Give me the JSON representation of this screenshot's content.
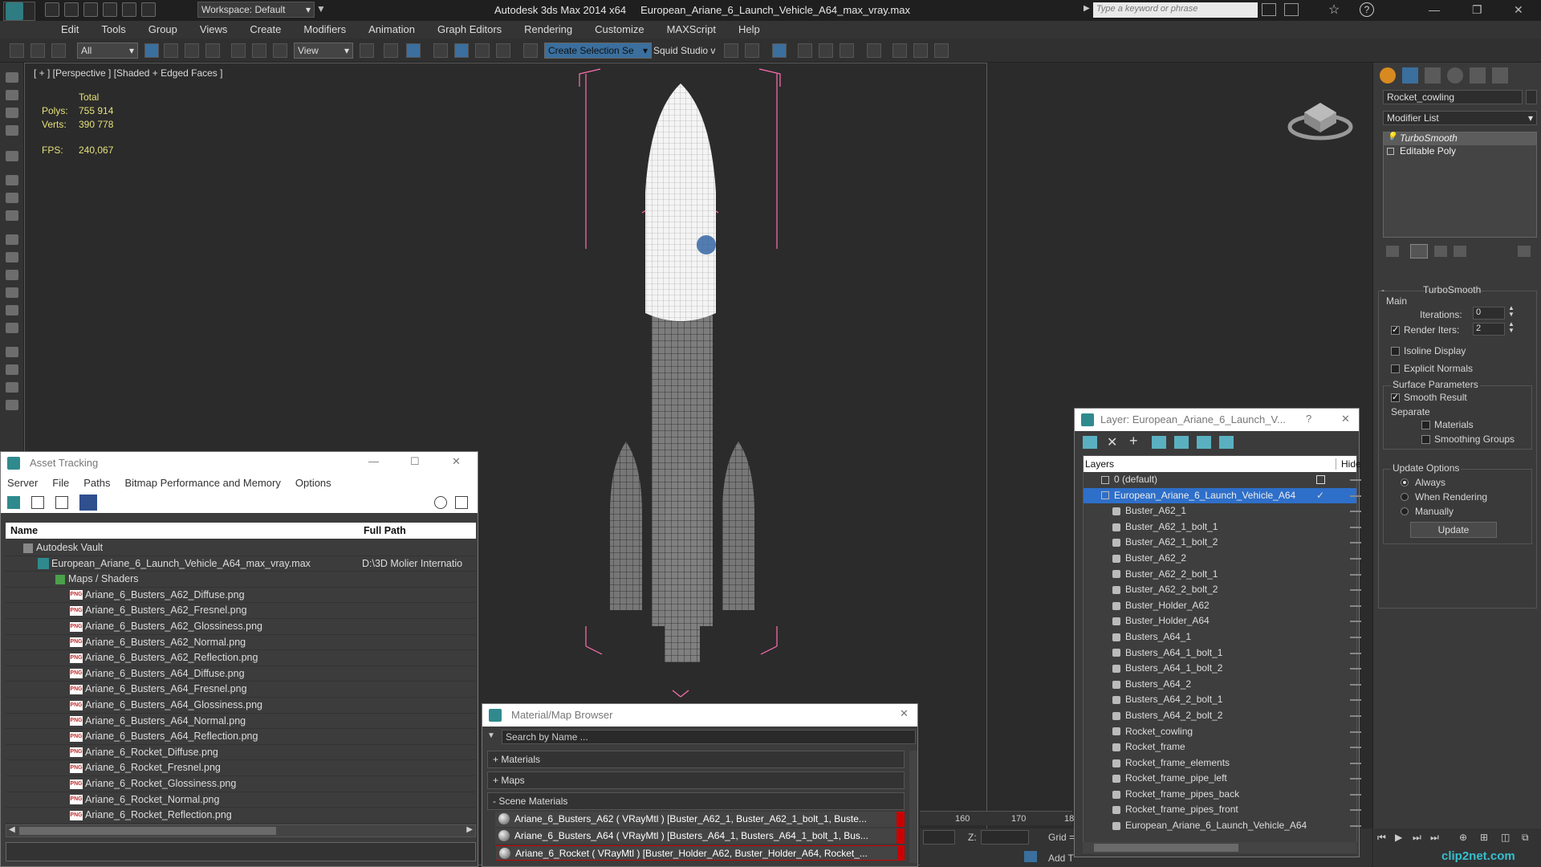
{
  "titlebar": {
    "workspace": "Workspace: Default",
    "app_name": "Autodesk 3ds Max  2014 x64",
    "file_name": "European_Ariane_6_Launch_Vehicle_A64_max_vray.max",
    "search_placeholder": "Type a keyword or phrase"
  },
  "menubar": [
    "Edit",
    "Tools",
    "Group",
    "Views",
    "Create",
    "Modifiers",
    "Animation",
    "Graph Editors",
    "Rendering",
    "Customize",
    "MAXScript",
    "Help"
  ],
  "toolbar": {
    "filter": "All",
    "ref_coord": "View",
    "selection_set": "Create Selection Se",
    "squid": "Squid Studio v"
  },
  "viewport": {
    "label": "[ + ] [Perspective ] [Shaded + Edged Faces ]",
    "stats": {
      "total_label": "Total",
      "polys_label": "Polys:",
      "polys_value": "755 914",
      "verts_label": "Verts:",
      "verts_value": "390 778",
      "fps_label": "FPS:",
      "fps_value": "240,067"
    }
  },
  "command_panel": {
    "object_name": "Rocket_cowling",
    "modifier_list": "Modifier List",
    "stack": [
      "TurboSmooth",
      "Editable Poly"
    ],
    "rollout_title": "TurboSmooth",
    "main_label": "Main",
    "iterations_label": "Iterations:",
    "iterations_value": "0",
    "render_iters_label": "Render Iters:",
    "render_iters_value": "2",
    "isoline_label": "Isoline Display",
    "explicit_label": "Explicit Normals",
    "surface_label": "Surface Parameters",
    "smooth_result_label": "Smooth Result",
    "separate_label": "Separate",
    "materials_label": "Materials",
    "smoothing_groups_label": "Smoothing Groups",
    "update_options_label": "Update Options",
    "always_label": "Always",
    "when_rendering_label": "When Rendering",
    "manually_label": "Manually",
    "update_button": "Update"
  },
  "asset_tracking": {
    "title": "Asset Tracking",
    "menu": [
      "Server",
      "File",
      "Paths",
      "Bitmap Performance and Memory",
      "Options"
    ],
    "col_name": "Name",
    "col_path": "Full Path",
    "vault": "Autodesk Vault",
    "max_file": "European_Ariane_6_Launch_Vehicle_A64_max_vray.max",
    "max_path": "D:\\3D Molier Internatio",
    "maps_folder": "Maps / Shaders",
    "maps": [
      "Ariane_6_Busters_A62_Diffuse.png",
      "Ariane_6_Busters_A62_Fresnel.png",
      "Ariane_6_Busters_A62_Glossiness.png",
      "Ariane_6_Busters_A62_Normal.png",
      "Ariane_6_Busters_A62_Reflection.png",
      "Ariane_6_Busters_A64_Diffuse.png",
      "Ariane_6_Busters_A64_Fresnel.png",
      "Ariane_6_Busters_A64_Glossiness.png",
      "Ariane_6_Busters_A64_Normal.png",
      "Ariane_6_Busters_A64_Reflection.png",
      "Ariane_6_Rocket_Diffuse.png",
      "Ariane_6_Rocket_Fresnel.png",
      "Ariane_6_Rocket_Glossiness.png",
      "Ariane_6_Rocket_Normal.png",
      "Ariane_6_Rocket_Reflection.png"
    ]
  },
  "layer_window": {
    "title": "Layer: European_Ariane_6_Launch_V...",
    "help": "?",
    "col_layers": "Layers",
    "col_hide": "Hide",
    "default_layer": "0 (default)",
    "active_layer": "European_Ariane_6_Launch_Vehicle_A64",
    "objects": [
      "Buster_A62_1",
      "Buster_A62_1_bolt_1",
      "Buster_A62_1_bolt_2",
      "Buster_A62_2",
      "Buster_A62_2_bolt_1",
      "Buster_A62_2_bolt_2",
      "Buster_Holder_A62",
      "Buster_Holder_A64",
      "Busters_A64_1",
      "Busters_A64_1_bolt_1",
      "Busters_A64_1_bolt_2",
      "Busters_A64_2",
      "Busters_A64_2_bolt_1",
      "Busters_A64_2_bolt_2",
      "Rocket_cowling",
      "Rocket_frame",
      "Rocket_frame_elements",
      "Rocket_frame_pipe_left",
      "Rocket_frame_pipes_back",
      "Rocket_frame_pipes_front",
      "European_Ariane_6_Launch_Vehicle_A64"
    ]
  },
  "material_browser": {
    "title": "Material/Map Browser",
    "search_placeholder": "Search by Name ...",
    "sections": [
      "+ Materials",
      "+ Maps",
      "- Scene Materials"
    ],
    "materials": [
      "Ariane_6_Busters_A62  ( VRayMtl )  [Buster_A62_1, Buster_A62_1_bolt_1, Buste...",
      "Ariane_6_Busters_A64  ( VRayMtl )  [Busters_A64_1, Busters_A64_1_bolt_1, Bus...",
      "Ariane_6_Rocket  ( VRayMtl )  [Buster_Holder_A62, Buster_Holder_A64, Rocket_..."
    ]
  },
  "timeline": {
    "tick_160": "160",
    "tick_170": "170",
    "tick_18": "18",
    "z_label": "Z:",
    "grid_label": "Grid =",
    "add_t": "Add T"
  },
  "watermark": "clip2net.com"
}
